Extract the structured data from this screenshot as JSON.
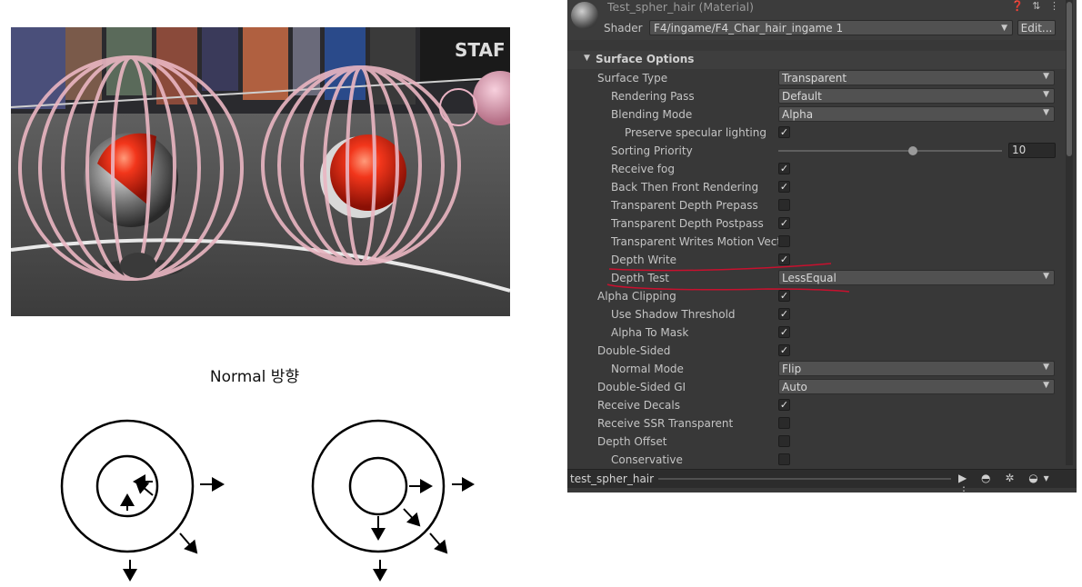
{
  "diagram": {
    "title": "Normal 방향"
  },
  "inspector": {
    "material_title": "Test_spher_hair (Material)",
    "header_icons": "❓ ⇅ ⋮",
    "shader_label": "Shader",
    "shader_value": "F4/ingame/F4_Char_hair_ingame 1",
    "edit_button": "Edit...",
    "section_title": "Surface Options",
    "rows": [
      {
        "label": "Surface Type",
        "indent": 0,
        "kind": "dropdown",
        "value": "Transparent"
      },
      {
        "label": "Rendering Pass",
        "indent": 1,
        "kind": "dropdown",
        "value": "Default"
      },
      {
        "label": "Blending Mode",
        "indent": 1,
        "kind": "dropdown",
        "value": "Alpha"
      },
      {
        "label": "Preserve specular lighting",
        "indent": 2,
        "kind": "check",
        "checked": true
      },
      {
        "label": "Sorting Priority",
        "indent": 1,
        "kind": "slider",
        "value": "10",
        "fraction": 0.6
      },
      {
        "label": "Receive fog",
        "indent": 1,
        "kind": "check",
        "checked": true
      },
      {
        "label": "Back Then Front Rendering",
        "indent": 1,
        "kind": "check",
        "checked": true
      },
      {
        "label": "Transparent Depth Prepass",
        "indent": 1,
        "kind": "check",
        "checked": false
      },
      {
        "label": "Transparent Depth Postpass",
        "indent": 1,
        "kind": "check",
        "checked": true
      },
      {
        "label": "Transparent Writes Motion Vectors",
        "indent": 1,
        "kind": "check",
        "checked": false
      },
      {
        "label": "Depth Write",
        "indent": 1,
        "kind": "check",
        "checked": true
      },
      {
        "label": "Depth Test",
        "indent": 1,
        "kind": "dropdown",
        "value": "LessEqual"
      },
      {
        "label": "Alpha Clipping",
        "indent": 0,
        "kind": "check",
        "checked": true
      },
      {
        "label": "Use Shadow Threshold",
        "indent": 1,
        "kind": "check",
        "checked": true
      },
      {
        "label": "Alpha To Mask",
        "indent": 1,
        "kind": "check",
        "checked": true
      },
      {
        "label": "Double-Sided",
        "indent": 0,
        "kind": "check",
        "checked": true
      },
      {
        "label": "Normal Mode",
        "indent": 1,
        "kind": "dropdown",
        "value": "Flip"
      },
      {
        "label": "Double-Sided GI",
        "indent": 0,
        "kind": "dropdown",
        "value": "Auto"
      },
      {
        "label": "Receive Decals",
        "indent": 0,
        "kind": "check",
        "checked": true
      },
      {
        "label": "Receive SSR Transparent",
        "indent": 0,
        "kind": "check",
        "checked": false
      },
      {
        "label": "Depth Offset",
        "indent": 0,
        "kind": "check",
        "checked": false
      },
      {
        "label": "Conservative",
        "indent": 1,
        "kind": "check",
        "checked": false
      }
    ],
    "footer_name": "test_spher_hair",
    "footer_icons": "▶ ◓ ✲ ◒▾ ⋮",
    "check_mark": "✓",
    "dropdown_arrow": "▼",
    "section_arrow": "▼"
  },
  "colors": {
    "annotation_red": "#c8102e",
    "panel_bg": "#383838"
  }
}
